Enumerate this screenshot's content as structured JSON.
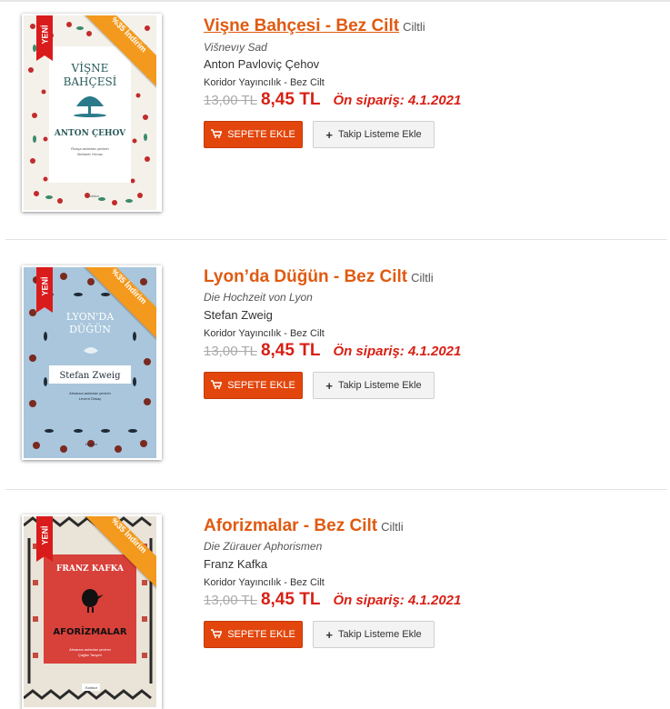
{
  "books": [
    {
      "title": "Vişne Bahçesi - Bez Cilt",
      "binding": "Ciltli",
      "original_title": "Višnevıy Sad",
      "author": "Anton Pavloviç Çehov",
      "publisher": "Koridor Yayıncılık - Bez Cilt",
      "old_price": "13,00 TL",
      "new_price": "8,45 TL",
      "preorder": "Ön sipariş: 4.1.2021",
      "cover": {
        "badge_new": "YENİ",
        "discount": "%35 İndirim",
        "title_line1": "VİŞNE",
        "title_line2": "BAHÇESİ",
        "author": "ANTON ÇEHOV",
        "translator_line1": "Rusça aslından çeviren",
        "translator_line2": "Mehmet Yılmaz",
        "imprint": "Koridor"
      }
    },
    {
      "title": "Lyon’da Düğün - Bez Cilt",
      "binding": "Ciltli",
      "original_title": "Die Hochzeit von Lyon",
      "author": "Stefan Zweig",
      "publisher": "Koridor Yayıncılık - Bez Cilt",
      "old_price": "13,00 TL",
      "new_price": "8,45 TL",
      "preorder": "Ön sipariş: 4.1.2021",
      "cover": {
        "badge_new": "YENİ",
        "discount": "%35 İndirim",
        "title_line1": "LYON'DA",
        "title_line2": "DÜĞÜN",
        "author": "Stefan Zweig",
        "translator_line1": "Almanca aslından çeviren",
        "translator_line2": "Levent Özkaç",
        "imprint": "Koridor"
      }
    },
    {
      "title": "Aforizmalar - Bez Cilt",
      "binding": "Ciltli",
      "original_title": "Die Zürauer Aphorismen",
      "author": "Franz Kafka",
      "publisher": "Koridor Yayıncılık - Bez Cilt",
      "old_price": "13,00 TL",
      "new_price": "8,45 TL",
      "preorder": "Ön sipariş: 4.1.2021",
      "cover": {
        "badge_new": "YENİ",
        "discount": "%35 İndirim",
        "title_line1": "FRANZ KAFKA",
        "title_line2": "AFORİZMALAR",
        "author": "",
        "translator_line1": "Almanca aslından çeviren",
        "translator_line2": "Çağlar Tanyeri",
        "imprint": "Koridor"
      }
    }
  ],
  "actions": {
    "cart_label": "SEPETE EKLE",
    "follow_label": "Takip Listeme Ekle"
  },
  "icons": {
    "cart": "cart-icon",
    "plus": "plus-icon"
  },
  "colors": {
    "accent": "#e05a10",
    "price": "#d81f14",
    "cart_button": "#e2460c",
    "badge_red": "#d91b1b",
    "discount_orange": "#f39a1e"
  }
}
